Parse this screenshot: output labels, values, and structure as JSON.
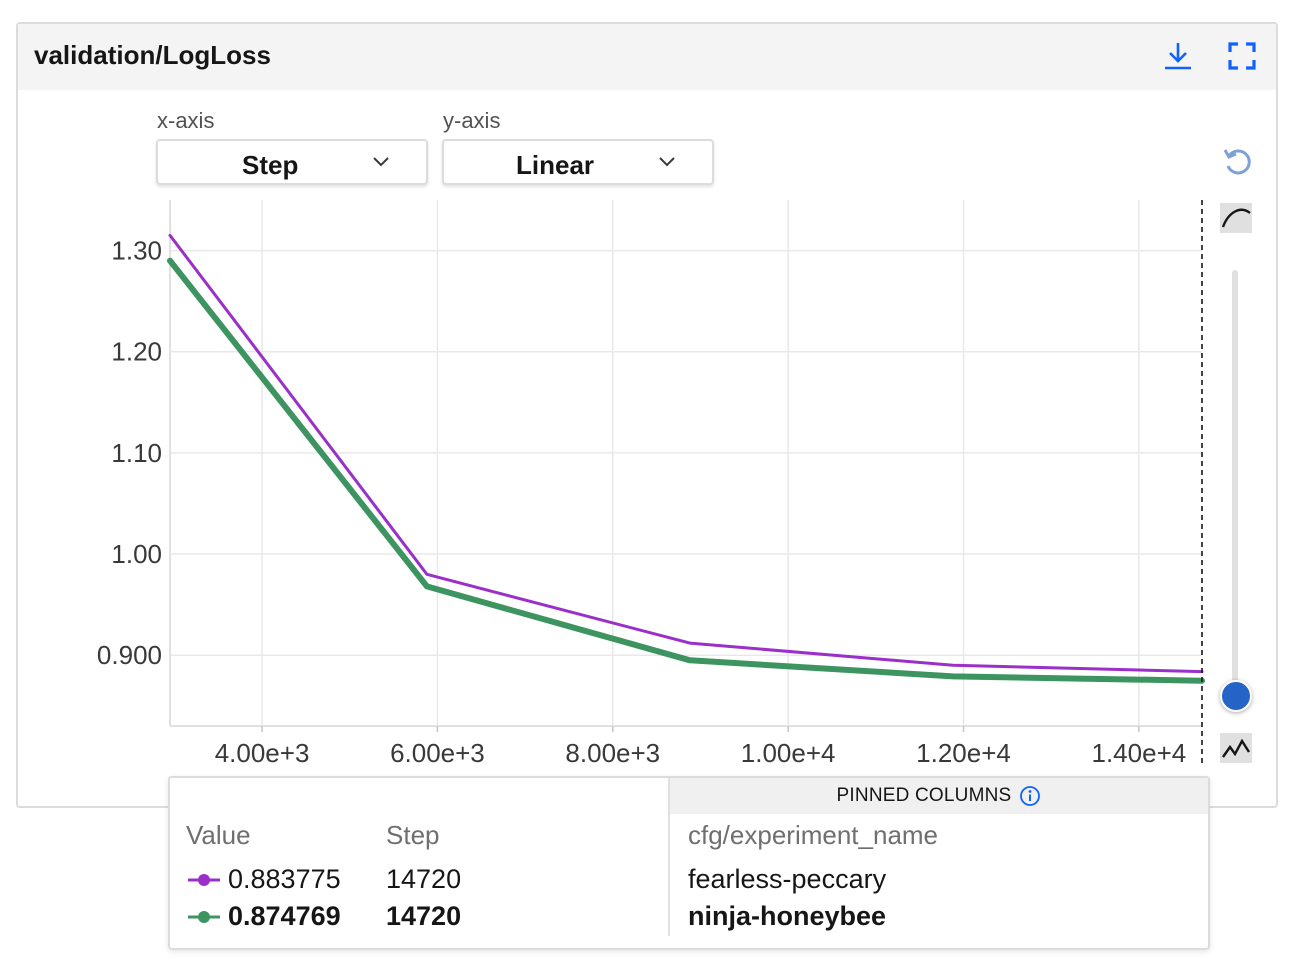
{
  "panel": {
    "title": "validation/LogLoss"
  },
  "controls": {
    "x_axis": {
      "label": "x-axis",
      "value": "Step"
    },
    "y_axis": {
      "label": "y-axis",
      "value": "Linear"
    }
  },
  "icons": {
    "download": "download-icon",
    "fullscreen": "fullscreen-icon",
    "reset": "reset-icon",
    "smoothing_max": "smooth-curve-icon",
    "smoothing_min": "raw-line-icon"
  },
  "colors": {
    "accent": "#0f62fe",
    "purple": "#9b2fc9",
    "green": "#3d9460",
    "slider_knob": "#2563c7"
  },
  "chart_data": {
    "type": "line",
    "xlim": [
      2950,
      14720
    ],
    "ylim": [
      0.83,
      1.35
    ],
    "x_ticks": [
      4000,
      6000,
      8000,
      10000,
      12000,
      14000
    ],
    "x_tick_labels": [
      "4.00e+3",
      "6.00e+3",
      "8.00e+3",
      "1.00e+4",
      "1.20e+4",
      "1.40e+4"
    ],
    "y_ticks": [
      0.9,
      1.0,
      1.1,
      1.2,
      1.3
    ],
    "y_tick_labels": [
      "0.900",
      "1.00",
      "1.10",
      "1.20",
      "1.30"
    ],
    "grid": true,
    "cursor_x": 14720,
    "series": [
      {
        "name": "fearless-peccary",
        "color": "#9b2fc9",
        "width": 3,
        "x": [
          2950,
          5880,
          8880,
          11880,
          14720
        ],
        "y": [
          1.315,
          0.98,
          0.912,
          0.89,
          0.883775
        ]
      },
      {
        "name": "ninja-honeybee",
        "color": "#3d9460",
        "width": 6,
        "x": [
          2950,
          5880,
          8880,
          11880,
          14720
        ],
        "y": [
          1.29,
          0.968,
          0.895,
          0.879,
          0.874769
        ]
      }
    ]
  },
  "tooltip": {
    "pinned_header": "PINNED COLUMNS",
    "columns": {
      "value": "Value",
      "step": "Step",
      "experiment": "cfg/experiment_name"
    },
    "rows": [
      {
        "value": "0.883775",
        "step": "14720",
        "experiment": "fearless-peccary",
        "color": "#9b2fc9"
      },
      {
        "value": "0.874769",
        "step": "14720",
        "experiment": "ninja-honeybee",
        "color": "#3d9460"
      }
    ]
  }
}
